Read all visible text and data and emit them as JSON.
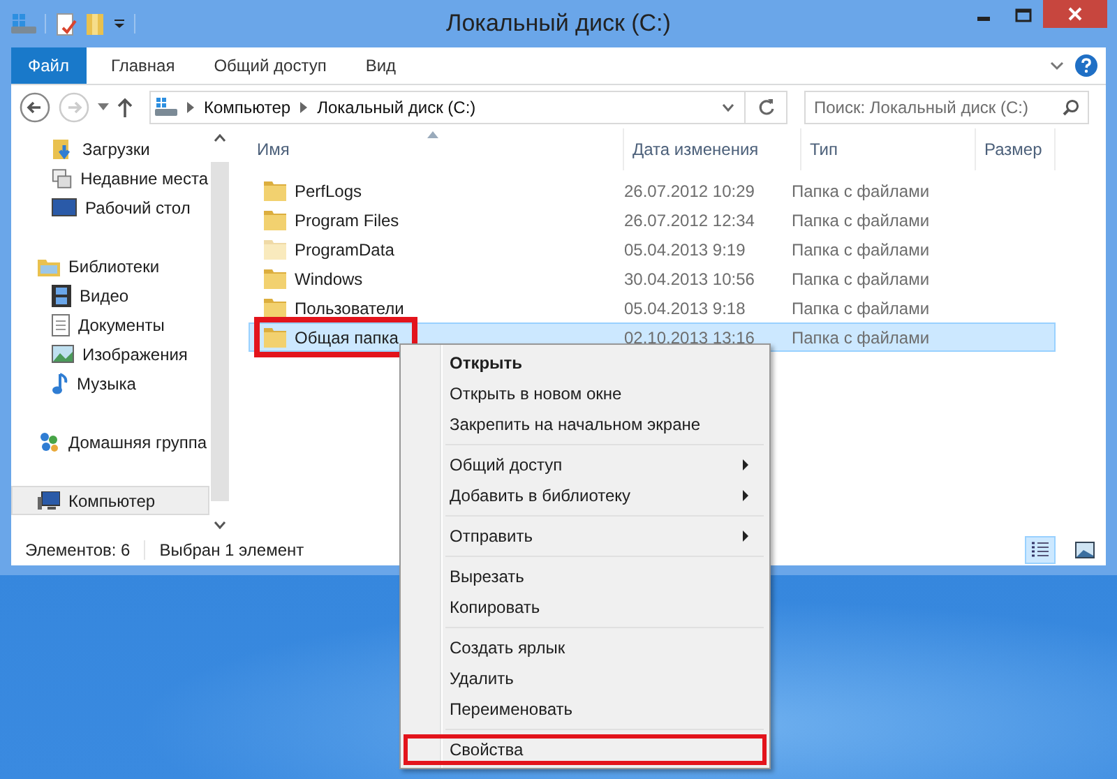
{
  "window": {
    "title": "Локальный диск (C:)"
  },
  "ribbon": {
    "tabs": [
      {
        "label": "Файл",
        "kind": "file"
      },
      {
        "label": "Главная",
        "kind": "tab"
      },
      {
        "label": "Общий доступ",
        "kind": "tab"
      },
      {
        "label": "Вид",
        "kind": "tab"
      }
    ]
  },
  "address": {
    "path": [
      "Компьютер",
      "Локальный диск (C:)"
    ]
  },
  "search": {
    "placeholder": "Поиск: Локальный диск (C:)"
  },
  "sidebar": {
    "sections": [
      {
        "children": [
          {
            "label": "Загрузки",
            "kind": "downloads",
            "selected": false
          },
          {
            "label": "Недавние места",
            "kind": "recent",
            "selected": false
          },
          {
            "label": "Рабочий стол",
            "kind": "desktop",
            "selected": false
          }
        ]
      },
      {
        "label": "Библиотеки",
        "kind": "libraries",
        "selected": false,
        "children": [
          {
            "label": "Видео",
            "kind": "video",
            "selected": false
          },
          {
            "label": "Документы",
            "kind": "documents",
            "selected": false
          },
          {
            "label": "Изображения",
            "kind": "pictures",
            "selected": false
          },
          {
            "label": "Музыка",
            "kind": "music",
            "selected": false
          }
        ]
      },
      {
        "label": "Домашняя группа",
        "kind": "homegroup",
        "selected": false
      },
      {
        "label": "Компьютер",
        "kind": "computer",
        "selected": true
      }
    ]
  },
  "table": {
    "columns": [
      "Имя",
      "Дата изменения",
      "Тип",
      "Размер"
    ],
    "rows": [
      {
        "name": "PerfLogs",
        "date": "26.07.2012 10:29",
        "type": "Папка с файлами",
        "hidden": false,
        "selected": false,
        "highlighted": false
      },
      {
        "name": "Program Files",
        "date": "26.07.2012 12:34",
        "type": "Папка с файлами",
        "hidden": false,
        "selected": false,
        "highlighted": false
      },
      {
        "name": "ProgramData",
        "date": "05.04.2013 9:19",
        "type": "Папка с файлами",
        "hidden": true,
        "selected": false,
        "highlighted": false
      },
      {
        "name": "Windows",
        "date": "30.04.2013 10:56",
        "type": "Папка с файлами",
        "hidden": false,
        "selected": false,
        "highlighted": false
      },
      {
        "name": "Пользователи",
        "date": "05.04.2013 9:18",
        "type": "Папка с файлами",
        "hidden": false,
        "selected": false,
        "highlighted": false
      },
      {
        "name": "Общая папка",
        "date": "02.10.2013 13:16",
        "type": "Папка с файлами",
        "hidden": false,
        "selected": true,
        "highlighted": true
      }
    ]
  },
  "status_bar": {
    "count": "Элементов: 6",
    "selection": "Выбран 1 элемент",
    "views": [
      {
        "kind": "details",
        "selected": true
      },
      {
        "kind": "tiles",
        "selected": false
      }
    ]
  },
  "context_menu": {
    "groups": [
      [
        {
          "label": "Открыть",
          "bold": true,
          "submenu": false,
          "highlighted": false
        },
        {
          "label": "Открыть в новом окне",
          "bold": false,
          "submenu": false,
          "highlighted": false
        },
        {
          "label": "Закрепить на начальном экране",
          "bold": false,
          "submenu": false,
          "highlighted": false
        }
      ],
      [
        {
          "label": "Общий доступ",
          "bold": false,
          "submenu": true,
          "highlighted": false
        },
        {
          "label": "Добавить в библиотеку",
          "bold": false,
          "submenu": true,
          "highlighted": false
        }
      ],
      [
        {
          "label": "Отправить",
          "bold": false,
          "submenu": true,
          "highlighted": false
        }
      ],
      [
        {
          "label": "Вырезать",
          "bold": false,
          "submenu": false,
          "highlighted": false
        },
        {
          "label": "Копировать",
          "bold": false,
          "submenu": false,
          "highlighted": false
        }
      ],
      [
        {
          "label": "Создать ярлык",
          "bold": false,
          "submenu": false,
          "highlighted": false
        },
        {
          "label": "Удалить",
          "bold": false,
          "submenu": false,
          "highlighted": false
        },
        {
          "label": "Переименовать",
          "bold": false,
          "submenu": false,
          "highlighted": false
        }
      ],
      [
        {
          "label": "Свойства",
          "bold": false,
          "submenu": false,
          "highlighted": true
        }
      ]
    ]
  }
}
